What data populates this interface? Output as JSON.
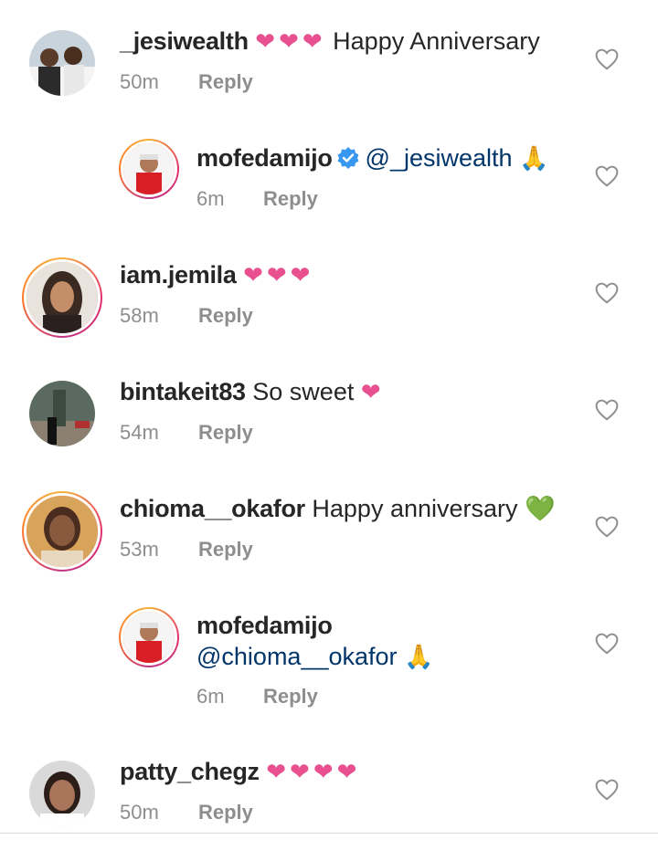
{
  "comments": [
    {
      "username": "_jesiwealth",
      "hearts": "❤❤❤",
      "text": "Happy Anniversary",
      "time": "50m",
      "reply": "Reply"
    },
    {
      "username": "mofedamijo",
      "mention": "@_jesiwealth",
      "emoji": "🙏",
      "time": "6m",
      "reply": "Reply"
    },
    {
      "username": "iam.jemila",
      "hearts": "❤❤❤",
      "time": "58m",
      "reply": "Reply"
    },
    {
      "username": "bintakeit83",
      "text": "So sweet",
      "hearts": "❤",
      "time": "54m",
      "reply": "Reply"
    },
    {
      "username": "chioma__okafor",
      "text": "Happy anniversary",
      "emoji": "💚",
      "time": "53m",
      "reply": "Reply"
    },
    {
      "username": "mofedamijo",
      "mention": "@chioma__okafor",
      "emoji": "🙏",
      "time": "6m",
      "reply": "Reply"
    },
    {
      "username": "patty_chegz",
      "hearts": "❤❤❤❤",
      "time": "50m",
      "reply": "Reply"
    }
  ],
  "icons": {
    "like": "heart-outline-icon",
    "verified": "verified-badge-icon"
  },
  "colors": {
    "text": "#262626",
    "meta": "#8e8e8e",
    "mention": "#003569",
    "heart": "#e8508f",
    "verified": "#3897f0"
  }
}
